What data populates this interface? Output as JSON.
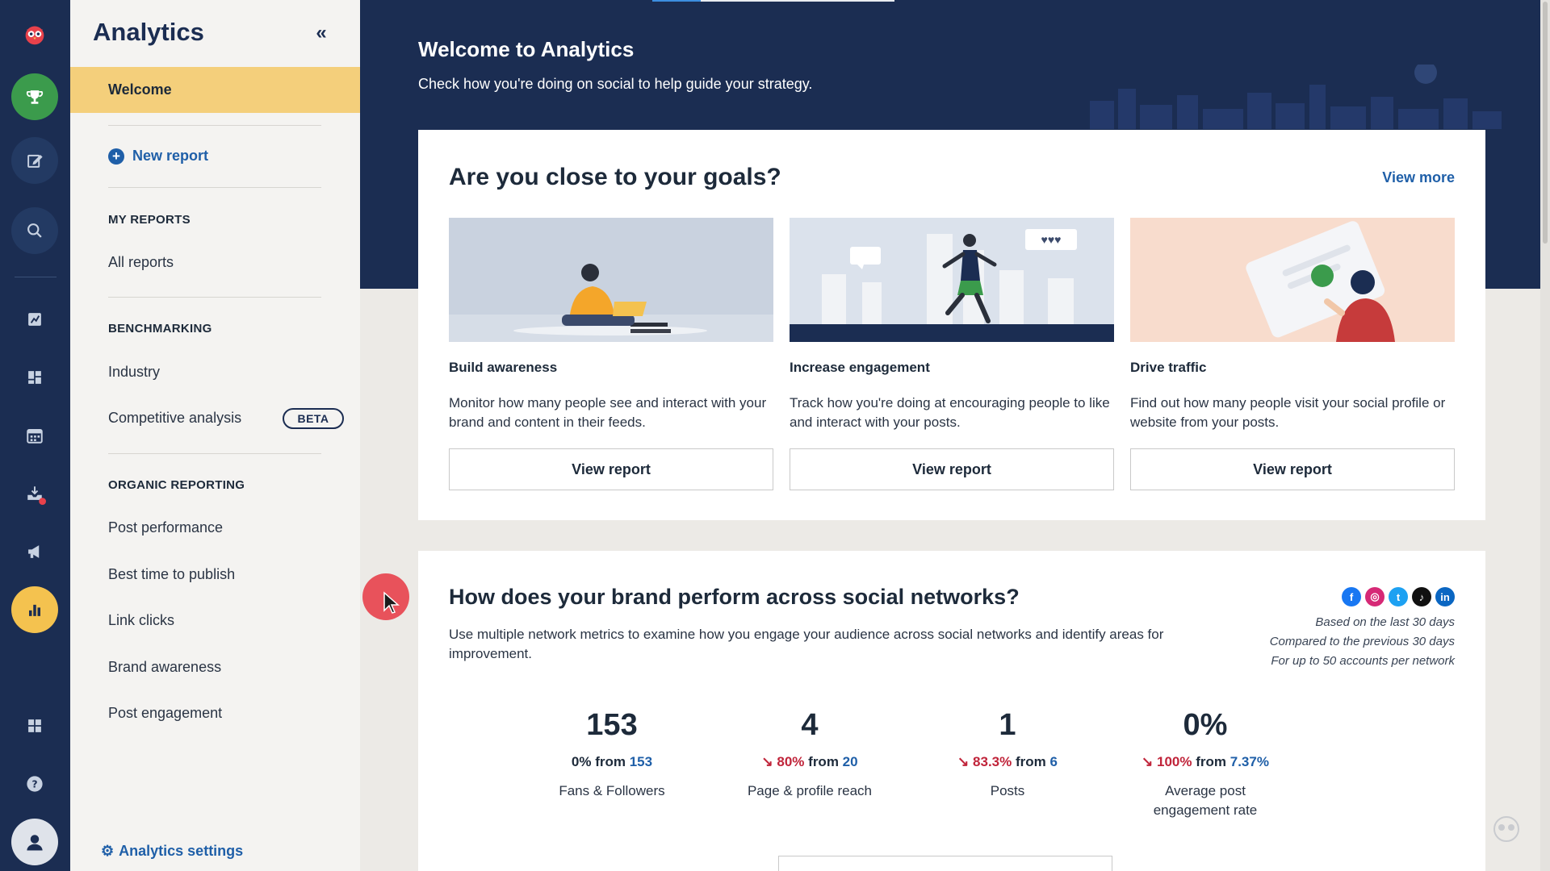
{
  "sidebar": {
    "title": "Analytics",
    "collapse_icon": "«",
    "welcome": "Welcome",
    "new_report": "New report",
    "my_reports_heading": "MY REPORTS",
    "all_reports": "All reports",
    "benchmarking_heading": "BENCHMARKING",
    "industry": "Industry",
    "competitive_analysis": "Competitive analysis",
    "beta_badge": "BETA",
    "organic_heading": "ORGANIC REPORTING",
    "organic_items": [
      "Post performance",
      "Best time to publish",
      "Link clicks",
      "Brand awareness",
      "Post engagement"
    ],
    "settings": "Analytics settings"
  },
  "rail": {
    "icons": [
      "owl-logo",
      "trophy",
      "compose",
      "search",
      "analytics-reports",
      "dashboard",
      "calendar",
      "inbox",
      "megaphone",
      "analytics",
      "apps",
      "help",
      "profile"
    ],
    "active_color": "#f4c24f",
    "green_color": "#3b9b4c"
  },
  "hero": {
    "title": "Welcome to Analytics",
    "subtitle": "Check how you're doing on social to help guide your strategy."
  },
  "goals": {
    "title": "Are you close to your goals?",
    "view_more": "View more",
    "cards": [
      {
        "title": "Build awareness",
        "desc": "Monitor how many people see and interact with your brand and content in their feeds.",
        "button": "View report"
      },
      {
        "title": "Increase engagement",
        "desc": "Track how you're doing at encouraging people to like and interact with your posts.",
        "button": "View report"
      },
      {
        "title": "Drive traffic",
        "desc": "Find out how many people visit your social profile or website from your posts.",
        "button": "View report"
      }
    ]
  },
  "networks": {
    "title": "How does your brand perform across social networks?",
    "desc": "Use multiple network metrics to examine how you engage your audience across social networks and identify areas for improvement.",
    "icons": [
      "facebook",
      "instagram",
      "twitter",
      "tiktok",
      "linkedin"
    ],
    "icon_glyphs": [
      "f",
      "◎",
      "t",
      "♪",
      "in"
    ],
    "meta": [
      "Based on the last 30 days",
      "Compared to the previous 30 days",
      "For up to 50 accounts per network"
    ],
    "stats": [
      {
        "value": "153",
        "change": "0%",
        "from_word": "from",
        "prev": "153",
        "label": "Fans & Followers",
        "down": false
      },
      {
        "value": "4",
        "change": "80%",
        "from_word": "from",
        "prev": "20",
        "label": "Page & profile reach",
        "down": true
      },
      {
        "value": "1",
        "change": "83.3%",
        "from_word": "from",
        "prev": "6",
        "label": "Posts",
        "down": true
      },
      {
        "value": "0%",
        "change": "100%",
        "from_word": "from",
        "prev": "7.37%",
        "label": "Average post engagement rate",
        "down": true
      }
    ]
  }
}
